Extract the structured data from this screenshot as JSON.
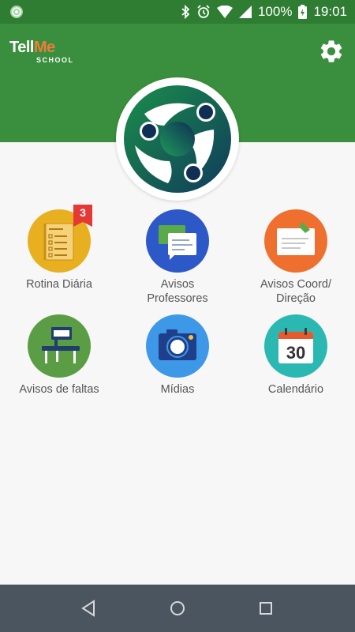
{
  "status_bar": {
    "battery": "100%",
    "time": "19:01"
  },
  "brand": {
    "name_part1": "Tell",
    "name_part2": "Me",
    "subtitle": "SCHOOL"
  },
  "menu": {
    "items": [
      {
        "label": "Rotina Diária",
        "badge": "3"
      },
      {
        "label": "Avisos Professores"
      },
      {
        "label": "Avisos Coord/ Direção"
      },
      {
        "label": "Avisos de faltas"
      },
      {
        "label": "Mídias"
      },
      {
        "label": "Calendário",
        "calendar_day": "30"
      }
    ]
  },
  "colors": {
    "status_bar": "#2e7d32",
    "header": "#3a8f3e",
    "rotina": "#e8b021",
    "avisos_prof": "#2d58c8",
    "avisos_coord": "#ef6f2e",
    "faltas": "#5b9d45",
    "midias": "#3d98e8",
    "calendario": "#2bb8b2",
    "nav_bar": "#4a5560"
  },
  "icons": {
    "settings": "gear-icon",
    "back": "back-triangle-icon",
    "home": "home-circle-icon",
    "recents": "recents-square-icon"
  }
}
